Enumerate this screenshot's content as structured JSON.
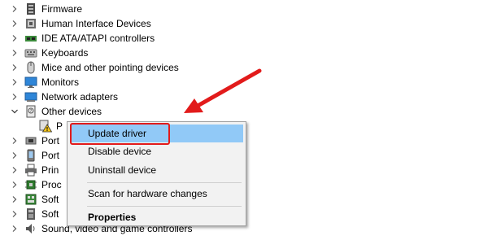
{
  "tree": {
    "items": [
      {
        "label": "Firmware",
        "icon": "firmware-icon",
        "expanded": false
      },
      {
        "label": "Human Interface Devices",
        "icon": "hid-icon",
        "expanded": false
      },
      {
        "label": "IDE ATA/ATAPI controllers",
        "icon": "ide-controller-icon",
        "expanded": false
      },
      {
        "label": "Keyboards",
        "icon": "keyboard-icon",
        "expanded": false
      },
      {
        "label": "Mice and other pointing devices",
        "icon": "mouse-icon",
        "expanded": false
      },
      {
        "label": "Monitors",
        "icon": "monitor-icon",
        "expanded": false
      },
      {
        "label": "Network adapters",
        "icon": "network-adapter-icon",
        "expanded": false
      },
      {
        "label": "Other devices",
        "icon": "other-devices-icon",
        "expanded": true
      },
      {
        "label": "P",
        "icon": "unknown-device-warning-icon",
        "child": true
      },
      {
        "label": "Port",
        "icon": "port-icon",
        "expanded": false
      },
      {
        "label": "Port",
        "icon": "port-icon",
        "expanded": false
      },
      {
        "label": "Prin",
        "icon": "printer-icon",
        "expanded": false
      },
      {
        "label": "Proc",
        "icon": "processor-icon",
        "expanded": false
      },
      {
        "label": "Soft",
        "icon": "software-component-icon",
        "expanded": false
      },
      {
        "label": "Soft",
        "icon": "software-device-icon",
        "expanded": false
      },
      {
        "label": "Sound, video and game controllers",
        "icon": "sound-icon",
        "expanded": false
      }
    ]
  },
  "context_menu": {
    "items": [
      {
        "label": "Update driver",
        "highlighted": true
      },
      {
        "label": "Disable device"
      },
      {
        "label": "Uninstall device"
      },
      {
        "label": "Scan for hardware changes"
      },
      {
        "label": "Properties",
        "bold": true
      }
    ]
  },
  "annotation": {
    "arrow_color": "#e21b1b",
    "box_color": "#e21b1b"
  },
  "colors": {
    "menu_background": "#f2f2f2",
    "highlight": "#91c9f7"
  }
}
